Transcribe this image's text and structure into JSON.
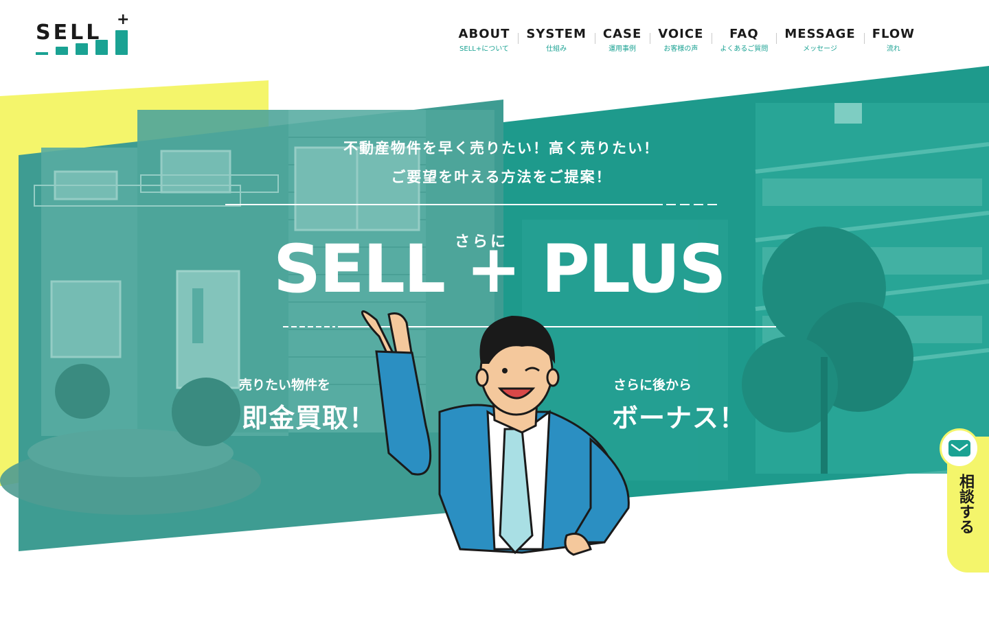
{
  "brand": {
    "logo_text": "SELL",
    "logo_plus": "+",
    "accent_color": "#1aa293",
    "highlight_color": "#f4f56b"
  },
  "nav": {
    "items": [
      {
        "en": "ABOUT",
        "ja": "SELL+について"
      },
      {
        "en": "SYSTEM",
        "ja": "仕組み"
      },
      {
        "en": "CASE",
        "ja": "運用事例"
      },
      {
        "en": "VOICE",
        "ja": "お客様の声"
      },
      {
        "en": "FAQ",
        "ja": "よくあるご質問"
      },
      {
        "en": "MESSAGE",
        "ja": "メッセージ"
      },
      {
        "en": "FLOW",
        "ja": "流れ"
      }
    ]
  },
  "hero": {
    "lead_line1": "不動産物件を早く売りたい！高く売りたい！",
    "lead_line2": "ご要望を叶える方法をご提案！",
    "ruby": "さらに",
    "title": "SELL + PLUS",
    "left_small": "売りたい物件を",
    "left_big": "即金買取！",
    "right_small": "さらに後から",
    "right_big": "ボーナス！"
  },
  "consult": {
    "label": "相談する",
    "icon": "mail-icon"
  }
}
